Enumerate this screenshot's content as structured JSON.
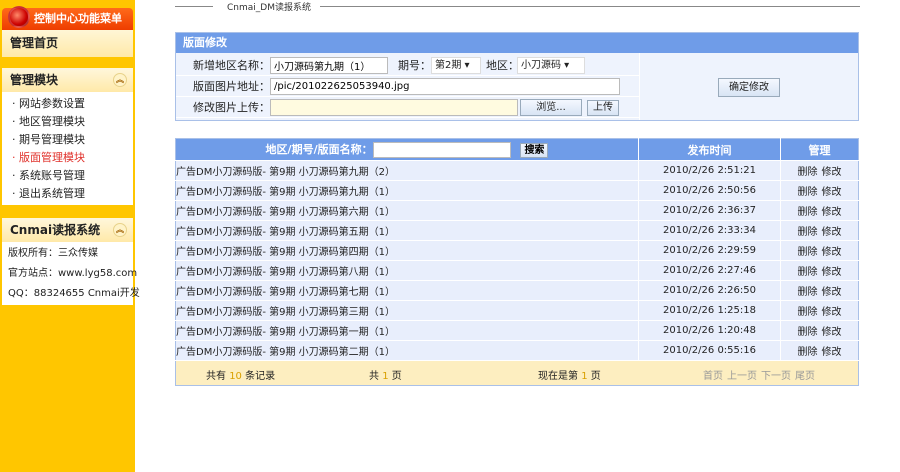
{
  "sidebar": {
    "header": "控制中心功能菜单",
    "home": "管理首页",
    "module_title": "管理模块",
    "items": [
      "· 网站参数设置",
      "· 地区管理模块",
      "· 期号管理模块",
      "· 版面管理模块",
      "· 系统账号管理",
      "· 退出系统管理"
    ],
    "info_title": "Cnmai读报系统",
    "info": [
      "版权所有：三众传媒",
      "官方站点：www.lyg58.com",
      "QQ：88324655 Cnmai开发"
    ]
  },
  "page_title": "Cnmai_DM读报系统",
  "form": {
    "title": "版面修改",
    "name_label": "新增地区名称：",
    "name_value": "小刀源码第九期（1）",
    "issue_label": "期号：",
    "issue_value": "第2期",
    "region_label": "地区：",
    "region_value": "小刀源码",
    "img_label": "版面图片地址：",
    "img_value": "/pic/201022625053940.jpg",
    "upload_label": "修改图片上传：",
    "browse": "浏览...",
    "upload": "上传",
    "submit": "确定修改"
  },
  "table": {
    "search_label": "地区/期号/版面名称：",
    "search_btn": "搜索",
    "col_time": "发布时间",
    "col_manage": "管理",
    "delete": "删除",
    "edit": "修改",
    "rows": [
      {
        "name": "广告DM小刀源码版- 第9期 小刀源码第九期（2）",
        "time": "2010/2/26 2:51:21"
      },
      {
        "name": "广告DM小刀源码版- 第9期 小刀源码第九期（1）",
        "time": "2010/2/26 2:50:56"
      },
      {
        "name": "广告DM小刀源码版- 第9期 小刀源码第六期（1）",
        "time": "2010/2/26 2:36:37"
      },
      {
        "name": "广告DM小刀源码版- 第9期 小刀源码第五期（1）",
        "time": "2010/2/26 2:33:34"
      },
      {
        "name": "广告DM小刀源码版- 第9期 小刀源码第四期（1）",
        "time": "2010/2/26 2:29:59"
      },
      {
        "name": "广告DM小刀源码版- 第9期 小刀源码第八期（1）",
        "time": "2010/2/26 2:27:46"
      },
      {
        "name": "广告DM小刀源码版- 第9期 小刀源码第七期（1）",
        "time": "2010/2/26 2:26:50"
      },
      {
        "name": "广告DM小刀源码版- 第9期 小刀源码第三期（1）",
        "time": "2010/2/26 1:25:18"
      },
      {
        "name": "广告DM小刀源码版- 第9期 小刀源码第一期（1）",
        "time": "2010/2/26 1:20:48"
      },
      {
        "name": "广告DM小刀源码版- 第9期 小刀源码第二期（1）",
        "time": "2010/2/26 0:55:16"
      }
    ]
  },
  "pager": {
    "total_pre": "共有",
    "total": "10",
    "total_post": "条记录",
    "pages_pre": "共",
    "pages": "1",
    "pages_post": "页",
    "cur_pre": "现在是第",
    "cur": "1",
    "cur_post": "页",
    "first": "首页",
    "prev": "上一页",
    "next": "下一页",
    "last": "尾页"
  }
}
